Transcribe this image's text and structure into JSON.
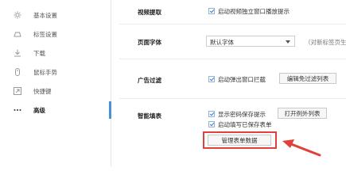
{
  "sidebar": {
    "items": [
      {
        "label": "基本设置",
        "icon": "gear-icon"
      },
      {
        "label": "标签设置",
        "icon": "tab-icon"
      },
      {
        "label": "下载",
        "icon": "download-icon"
      },
      {
        "label": "鼠标手势",
        "icon": "mouse-icon"
      },
      {
        "label": "快捷键",
        "icon": "keyboard-icon"
      },
      {
        "label": "高级",
        "icon": "more-icon",
        "active": true
      }
    ]
  },
  "main": {
    "video": {
      "label": "视频提取",
      "checkbox_label": "启动视频独立窗口播放提示",
      "checked": true
    },
    "font": {
      "label": "页面字体",
      "select_value": "默认字体",
      "note": "（对新标签页生"
    },
    "ads": {
      "label": "广告过滤",
      "checkbox_label": "启动弹出窗口拦截",
      "checked": true,
      "button_label": "编辑免过滤列表"
    },
    "autofill": {
      "label": "智能填表",
      "checkbox1_label": "显示密码保存提示",
      "checkbox1_checked": true,
      "exception_button_label": "打开例外列表",
      "checkbox2_label": "启动填写已保存表单",
      "checkbox2_checked": true,
      "manage_button_label": "管理表单数据"
    }
  },
  "colors": {
    "accent": "#4a90d9",
    "highlight": "#e0413b"
  }
}
